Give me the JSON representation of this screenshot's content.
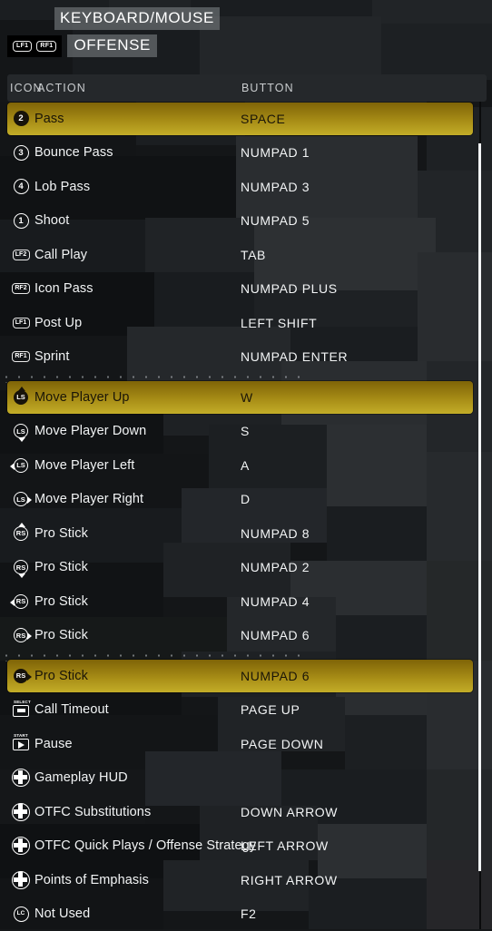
{
  "header": {
    "title": "KEYBOARD/MOUSE",
    "tab_label": "OFFENSE",
    "left_bumper": "LF1",
    "right_bumper": "RF1"
  },
  "columns": {
    "icon": "ICON",
    "action": "ACTION",
    "button": "BUTTON"
  },
  "colors": {
    "highlight_top": "#7f6407",
    "highlight_bottom": "#c3ad28",
    "panel": "#25282b",
    "background": "#141618",
    "text": "#f2f4f5",
    "header_chip": "#787c80"
  },
  "groups": [
    {
      "rows": [
        {
          "icon": "button-circle-2-icon",
          "icon_kind": "circle",
          "icon_label": "2",
          "action": "Pass",
          "button": "SPACE",
          "selected": true
        },
        {
          "icon": "button-circle-3-icon",
          "icon_kind": "circle",
          "icon_label": "3",
          "action": "Bounce Pass",
          "button": "NUMPAD 1",
          "selected": false
        },
        {
          "icon": "button-circle-4-icon",
          "icon_kind": "circle",
          "icon_label": "4",
          "action": "Lob Pass",
          "button": "NUMPAD 3",
          "selected": false
        },
        {
          "icon": "button-circle-1-icon",
          "icon_kind": "circle",
          "icon_label": "1",
          "action": "Shoot",
          "button": "NUMPAD 5",
          "selected": false
        },
        {
          "icon": "bumper-lf2-icon",
          "icon_kind": "bumper",
          "icon_label": "LF2",
          "action": "Call Play",
          "button": "TAB",
          "selected": false
        },
        {
          "icon": "bumper-rf2-icon",
          "icon_kind": "bumper",
          "icon_label": "RF2",
          "action": "Icon Pass",
          "button": "NUMPAD PLUS",
          "selected": false
        },
        {
          "icon": "bumper-lf1-icon",
          "icon_kind": "bumper",
          "icon_label": "LF1",
          "action": "Post Up",
          "button": "LEFT SHIFT",
          "selected": false
        },
        {
          "icon": "bumper-rf1-icon",
          "icon_kind": "bumper",
          "icon_label": "RF1",
          "action": "Sprint",
          "button": "NUMPAD ENTER",
          "selected": false
        }
      ]
    },
    {
      "rows": [
        {
          "icon": "left-stick-up-icon",
          "icon_kind": "stick",
          "icon_label": "LS",
          "dir": "up",
          "action": "Move Player Up",
          "button": "W",
          "selected": true
        },
        {
          "icon": "left-stick-down-icon",
          "icon_kind": "stick",
          "icon_label": "LS",
          "dir": "down",
          "action": "Move Player Down",
          "button": "S",
          "selected": false
        },
        {
          "icon": "left-stick-left-icon",
          "icon_kind": "stick",
          "icon_label": "LS",
          "dir": "left",
          "action": "Move Player Left",
          "button": "A",
          "selected": false
        },
        {
          "icon": "left-stick-right-icon",
          "icon_kind": "stick",
          "icon_label": "LS",
          "dir": "right",
          "action": "Move Player Right",
          "button": "D",
          "selected": false
        },
        {
          "icon": "right-stick-up-icon",
          "icon_kind": "stick",
          "icon_label": "RS",
          "dir": "up",
          "action": "Pro Stick",
          "button": "NUMPAD 8",
          "selected": false
        },
        {
          "icon": "right-stick-down-icon",
          "icon_kind": "stick",
          "icon_label": "RS",
          "dir": "down",
          "action": "Pro Stick",
          "button": "NUMPAD 2",
          "selected": false
        },
        {
          "icon": "right-stick-left-icon",
          "icon_kind": "stick",
          "icon_label": "RS",
          "dir": "left",
          "action": "Pro Stick",
          "button": "NUMPAD 4",
          "selected": false
        },
        {
          "icon": "right-stick-right-icon",
          "icon_kind": "stick",
          "icon_label": "RS",
          "dir": "right",
          "action": "Pro Stick",
          "button": "NUMPAD 6",
          "selected": false
        }
      ]
    },
    {
      "rows": [
        {
          "icon": "right-stick-right-icon",
          "icon_kind": "stick",
          "icon_label": "RS",
          "dir": "right",
          "action": "Pro Stick",
          "button": "NUMPAD 6",
          "selected": true
        },
        {
          "icon": "select-button-icon",
          "icon_kind": "select",
          "icon_label": "SELECT",
          "action": "Call Timeout",
          "button": "PAGE UP",
          "selected": false
        },
        {
          "icon": "start-button-icon",
          "icon_kind": "start",
          "icon_label": "START",
          "action": "Pause",
          "button": "PAGE DOWN",
          "selected": false
        },
        {
          "icon": "dpad-icon",
          "icon_kind": "dpad",
          "icon_label": "",
          "action": "Gameplay HUD",
          "button": "",
          "selected": false
        },
        {
          "icon": "dpad-icon",
          "icon_kind": "dpad",
          "icon_label": "",
          "action": "OTFC Substitutions",
          "button": "DOWN ARROW",
          "selected": false
        },
        {
          "icon": "dpad-icon",
          "icon_kind": "dpad",
          "icon_label": "",
          "action": "OTFC Quick Plays / Offense Strategy",
          "button": "LEFT ARROW",
          "selected": false
        },
        {
          "icon": "dpad-icon",
          "icon_kind": "dpad",
          "icon_label": "",
          "action": "Points of Emphasis",
          "button": "RIGHT ARROW",
          "selected": false
        },
        {
          "icon": "left-click-icon",
          "icon_kind": "circle",
          "icon_label": "LC",
          "action": "Not Used",
          "button": "F2",
          "selected": false
        }
      ]
    }
  ],
  "scrollbar": {
    "thumb_top_pct": 5,
    "thumb_height_pct": 88
  }
}
